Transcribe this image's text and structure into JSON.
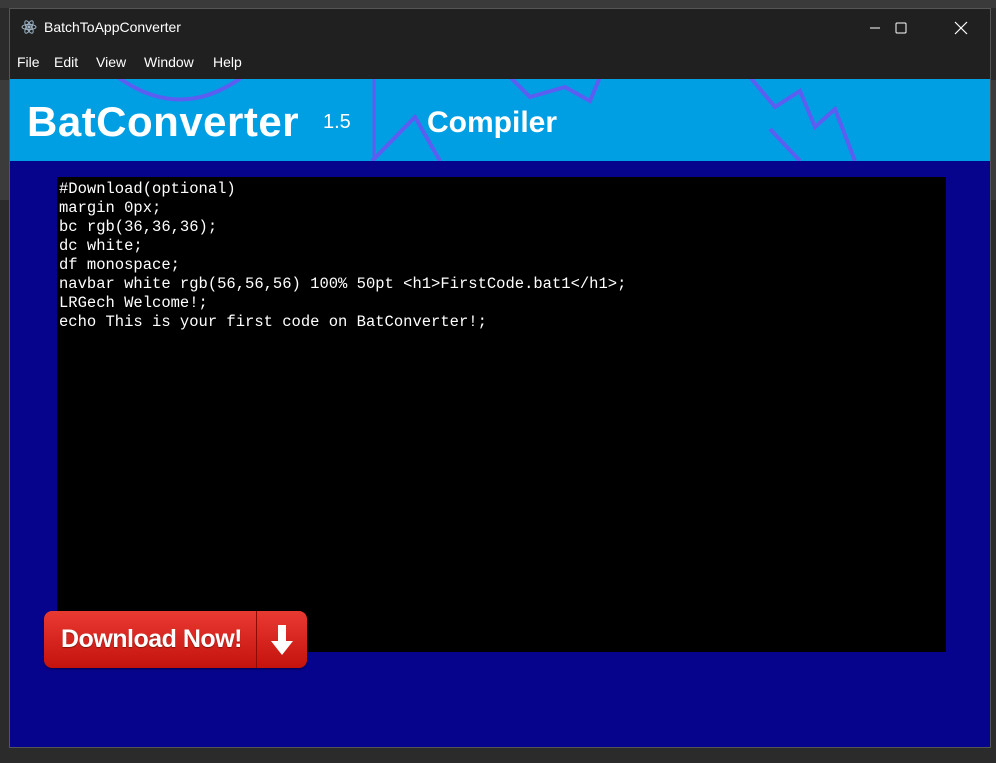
{
  "window": {
    "title": "BatchToAppConverter",
    "app_icon": "electron-icon",
    "controls": [
      "minimize-icon",
      "maximize-icon",
      "close-icon"
    ]
  },
  "menu": {
    "items": [
      "File",
      "Edit",
      "View",
      "Window",
      "Help"
    ]
  },
  "banner": {
    "brand": "BatConverter",
    "version": "1.5",
    "section": "Compiler",
    "color": "#009fe3"
  },
  "editor": {
    "content": "#Download(optional)\nmargin 0px;\nbc rgb(36,36,36);\ndc white;\ndf monospace;\nnavbar white rgb(56,56,56) 100% 50pt <h1>FirstCode.bat1</h1>;\nLRGech Welcome!;\necho This is your first code on BatConverter!;"
  },
  "download_button": {
    "label": "Download Now!",
    "icon": "down-arrow-icon",
    "color": "#d61f18"
  },
  "colors": {
    "background": "#06048c",
    "titlebar": "#202020",
    "editor_bg": "#000000"
  }
}
